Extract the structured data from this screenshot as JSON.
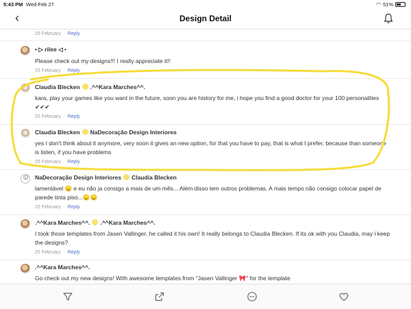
{
  "status_bar": {
    "time": "5:43 PM",
    "date": "Wed Feb 27",
    "battery": "51%"
  },
  "nav": {
    "title": "Design Detail",
    "back_icon": "chevron-left-icon",
    "bell_icon": "bell-icon"
  },
  "top_meta": {
    "date": "25 February",
    "reply": "Reply"
  },
  "comments": [
    {
      "author": "• ▷ rilee ◁ •",
      "reply_to": "",
      "text": "Please check out my designs!!! I really appreciate it!!",
      "date": "25 February",
      "reply": "Reply"
    },
    {
      "author": "Claudia Blecken",
      "reply_to": ".^^Kara Marches^^.",
      "text": "kara, play your games like you want in the future, soon you are history for me, i hope you find a good doctor for your 100 personalities ✔✔✔",
      "date": "25 February",
      "reply": "Reply"
    },
    {
      "author": "Claudia Blecken",
      "reply_to": "NaDecoração Design Interiores",
      "text": "yes I don't think about it anymore, very soon it gives an new option, for that you have to pay, that is what I prefer, because than someone is listen, if you have problems",
      "date": "25 February",
      "reply": "Reply"
    },
    {
      "author": "NaDecoração Design Interiores",
      "reply_to": "Claudia Blecken",
      "text": "lamentável 😞 e eu não ja consigo a mais de um mês... Além disso tem outros problemas. A mais tempo não consigo colocar papel de parede tinta piso...😞😞",
      "date": "25 February",
      "reply": "Reply"
    },
    {
      "author": ".^^Kara Marches^^.",
      "reply_to": ".^^Kara Marches^^.",
      "text": "I took those templates from Jasen Vallinger, he called it his own! It really belongs to Claudia Blecken. If its ok with you Claudia, may i keep the designs?",
      "date": "25 February",
      "reply": "Reply"
    },
    {
      "author": ".^^Kara Marches^^.",
      "reply_to": "",
      "text": "Go check out my new designs! With awesome templates from  \"Jasen Vallinger 🎀\" for the template",
      "date": "",
      "reply": ""
    }
  ],
  "bottom_bar": {
    "icons": [
      "filter-icon",
      "share-icon",
      "comment-icon",
      "heart-icon"
    ]
  },
  "colors": {
    "highlight": "#f5dc3a",
    "reply_link": "#4a6fbf",
    "meta": "#999999"
  }
}
